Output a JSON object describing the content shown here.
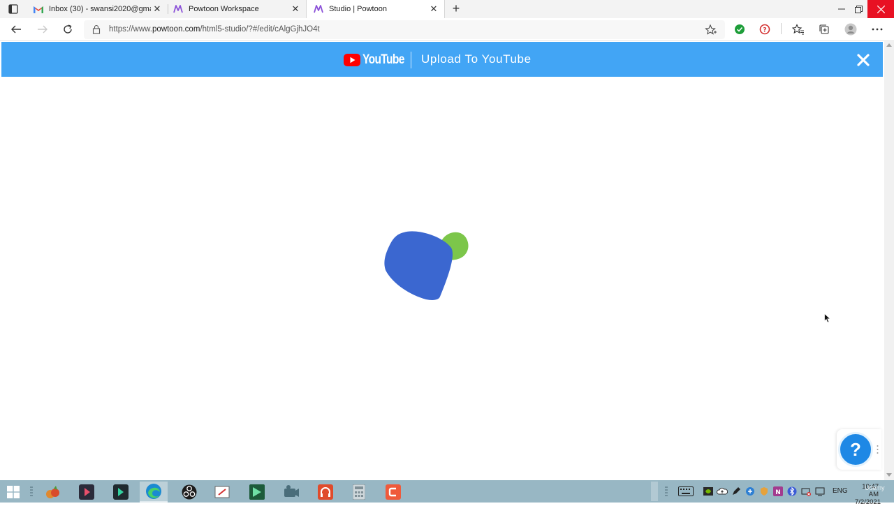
{
  "browser": {
    "tabs": [
      {
        "title": "Inbox (30) - swansi2020@gmail.c",
        "icon": "gmail-icon",
        "active": false
      },
      {
        "title": "Powtoon Workspace",
        "icon": "powtoon-icon",
        "active": false
      },
      {
        "title": "Studio | Powtoon",
        "icon": "powtoon-icon",
        "active": true
      }
    ],
    "url": {
      "prefix": "https://www.",
      "host": "powtoon.com",
      "path": "/html5-studio/?#/edit/cAlgGjhJO4t"
    }
  },
  "modal": {
    "brand": "YouTube",
    "title": "Upload To YouTube",
    "header_color": "#42a5f5",
    "close_icon": "close-icon"
  },
  "loader": {
    "colors": [
      "#3b67d0",
      "#7cc64a"
    ]
  },
  "help": {
    "label": "?"
  },
  "taskbar": {
    "language": "ENG",
    "time": "10:47 AM",
    "date": "7/2/2021",
    "watermark": "Udemy"
  }
}
